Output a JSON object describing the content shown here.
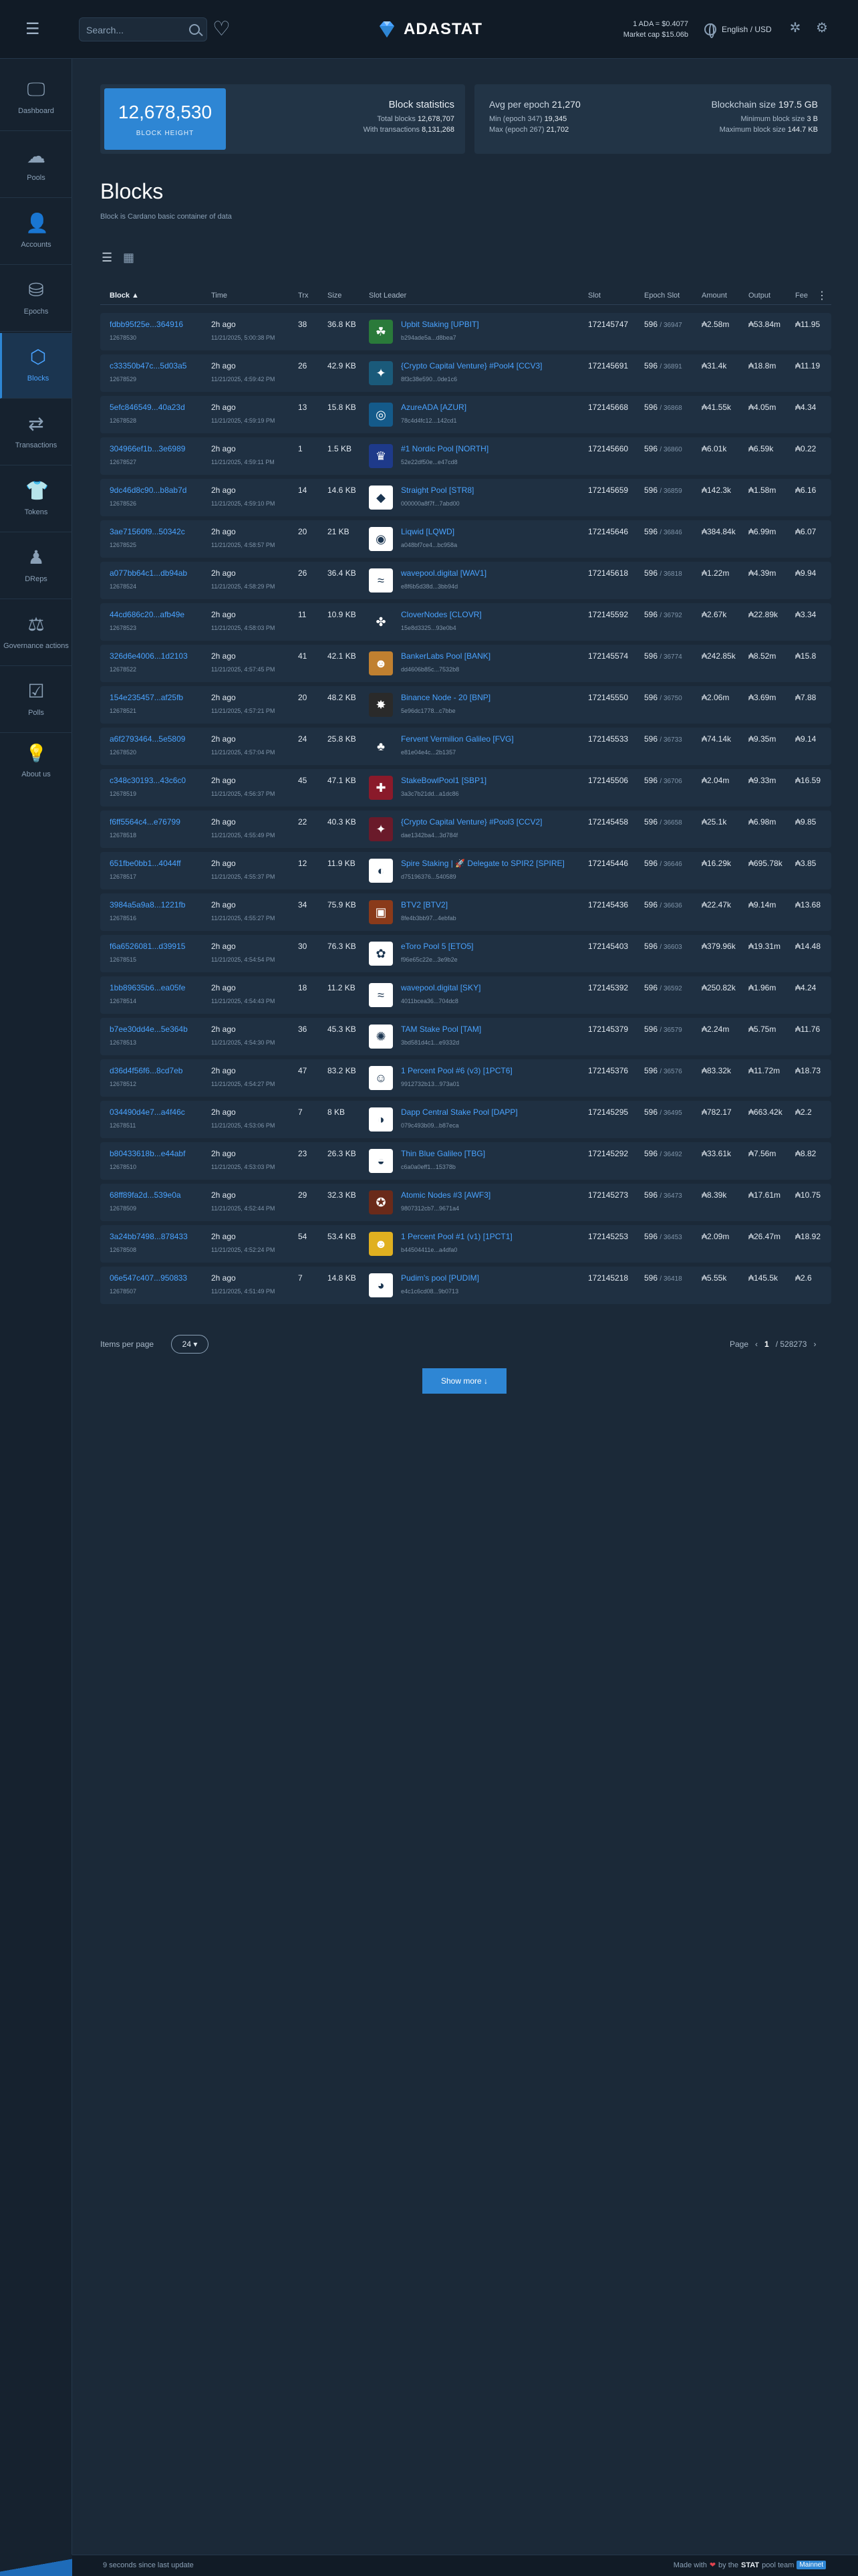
{
  "header": {
    "search_placeholder": "Search...",
    "logo_text": "ADASTAT",
    "price_line": "1 ADA = $0.4077",
    "mcap_line": "Market cap $15.06b",
    "language": "English / USD"
  },
  "sidebar": {
    "items": [
      {
        "label": "Dashboard",
        "icon": "monitor-icon"
      },
      {
        "label": "Pools",
        "icon": "cloud-icon"
      },
      {
        "label": "Accounts",
        "icon": "user-icon"
      },
      {
        "label": "Epochs",
        "icon": "stack-icon"
      },
      {
        "label": "Blocks",
        "icon": "cube-icon"
      },
      {
        "label": "Transactions",
        "icon": "transactions-icon"
      },
      {
        "label": "Tokens",
        "icon": "shirt-icon"
      },
      {
        "label": "DReps",
        "icon": "org-icon"
      },
      {
        "label": "Governance actions",
        "icon": "governance-icon"
      },
      {
        "label": "Polls",
        "icon": "poll-icon"
      }
    ],
    "about": "About us"
  },
  "stats": {
    "block_height": "12,678,530",
    "block_height_label": "BLOCK HEIGHT",
    "block_stats_title": "Block statistics",
    "total_blocks_label": "Total blocks",
    "total_blocks": "12,678,707",
    "with_tx_label": "With transactions",
    "with_tx": "8,131,268",
    "avg_epoch_label": "Avg per epoch",
    "avg_epoch": "21,270",
    "min_epoch_label": "Min (epoch 347)",
    "min_epoch": "19,345",
    "max_epoch_label": "Max (epoch 267)",
    "max_epoch": "21,702",
    "chain_size_label": "Blockchain size",
    "chain_size": "197.5 GB",
    "min_block_label": "Minimum block size",
    "min_block": "3 B",
    "max_block_label": "Maximum block size",
    "max_block": "144.7 KB"
  },
  "page": {
    "title": "Blocks",
    "description": "Block is Cardano basic container of data"
  },
  "table": {
    "columns": [
      "Block",
      "Time",
      "Trx",
      "Size",
      "Slot Leader",
      "Slot",
      "Epoch Slot",
      "Amount",
      "Output",
      "Fee"
    ],
    "rows": [
      {
        "hash": "fdbb95f25e...364916",
        "height": "12678530",
        "time": "2h ago",
        "date": "11/21/2025, 5:00:38 PM",
        "trx": "38",
        "size": "36.8 KB",
        "pool": "Upbit Staking [UPBIT]",
        "poolid": "b294ade5a...d8bea7",
        "slot": "172145747",
        "epoch": "596",
        "eslot": "36947",
        "amount": "₳2.58m",
        "output": "₳53.84m",
        "fee": "₳11.95",
        "icon": "☘",
        "bg": "#2a7a3a"
      },
      {
        "hash": "c33350b47c...5d03a5",
        "height": "12678529",
        "time": "2h ago",
        "date": "11/21/2025, 4:59:42 PM",
        "trx": "26",
        "size": "42.9 KB",
        "pool": "{Crypto Capital Venture} #Pool4 [CCV3]",
        "poolid": "8f3c38e590...0de1c6",
        "slot": "172145691",
        "epoch": "596",
        "eslot": "36891",
        "amount": "₳31.4k",
        "output": "₳18.8m",
        "fee": "₳11.19",
        "icon": "✦",
        "bg": "#1a5a7a"
      },
      {
        "hash": "5efc846549...40a23d",
        "height": "12678528",
        "time": "2h ago",
        "date": "11/21/2025, 4:59:19 PM",
        "trx": "13",
        "size": "15.8 KB",
        "pool": "AzureADA [AZUR]",
        "poolid": "78c4d4fc12...142cd1",
        "slot": "172145668",
        "epoch": "596",
        "eslot": "36868",
        "amount": "₳41.55k",
        "output": "₳4.05m",
        "fee": "₳4.34",
        "icon": "◎",
        "bg": "#145a8a"
      },
      {
        "hash": "304966ef1b...3e6989",
        "height": "12678527",
        "time": "2h ago",
        "date": "11/21/2025, 4:59:11 PM",
        "trx": "1",
        "size": "1.5 KB",
        "pool": "#1 Nordic Pool [NORTH]",
        "poolid": "52e22df50e...e47cd8",
        "slot": "172145660",
        "epoch": "596",
        "eslot": "36860",
        "amount": "₳6.01k",
        "output": "₳6.59k",
        "fee": "₳0.22",
        "icon": "♛",
        "bg": "#1e3a8a"
      },
      {
        "hash": "9dc46d8c90...b8ab7d",
        "height": "12678526",
        "time": "2h ago",
        "date": "11/21/2025, 4:59:10 PM",
        "trx": "14",
        "size": "14.6 KB",
        "pool": "Straight Pool [STR8]",
        "poolid": "000000a8f7f...7abd00",
        "slot": "172145659",
        "epoch": "596",
        "eslot": "36859",
        "amount": "₳142.3k",
        "output": "₳1.58m",
        "fee": "₳6.16",
        "icon": "◆",
        "bg": "#ffffff"
      },
      {
        "hash": "3ae71560f9...50342c",
        "height": "12678525",
        "time": "2h ago",
        "date": "11/21/2025, 4:58:57 PM",
        "trx": "20",
        "size": "21 KB",
        "pool": "Liqwid [LQWD]",
        "poolid": "a048bf7ce4...bc958a",
        "slot": "172145646",
        "epoch": "596",
        "eslot": "36846",
        "amount": "₳384.84k",
        "output": "₳6.99m",
        "fee": "₳6.07",
        "icon": "◉",
        "bg": "#ffffff"
      },
      {
        "hash": "a077bb64c1...db94ab",
        "height": "12678524",
        "time": "2h ago",
        "date": "11/21/2025, 4:58:29 PM",
        "trx": "26",
        "size": "36.4 KB",
        "pool": "wavepool.digital [WAV1]",
        "poolid": "e8f6b5d38d...3bb94d",
        "slot": "172145618",
        "epoch": "596",
        "eslot": "36818",
        "amount": "₳1.22m",
        "output": "₳4.39m",
        "fee": "₳9.94",
        "icon": "≈",
        "bg": "#ffffff"
      },
      {
        "hash": "44cd686c20...afb49e",
        "height": "12678523",
        "time": "2h ago",
        "date": "11/21/2025, 4:58:03 PM",
        "trx": "11",
        "size": "10.9 KB",
        "pool": "CloverNodes [CLOVR]",
        "poolid": "15e8d3325...93e0b4",
        "slot": "172145592",
        "epoch": "596",
        "eslot": "36792",
        "amount": "₳2.67k",
        "output": "₳22.89k",
        "fee": "₳3.34",
        "icon": "✤",
        "bg": "#1f3042"
      },
      {
        "hash": "326d6e4006...1d2103",
        "height": "12678522",
        "time": "2h ago",
        "date": "11/21/2025, 4:57:45 PM",
        "trx": "41",
        "size": "42.1 KB",
        "pool": "BankerLabs Pool [BANK]",
        "poolid": "dd4606b85c...7532b8",
        "slot": "172145574",
        "epoch": "596",
        "eslot": "36774",
        "amount": "₳242.85k",
        "output": "₳8.52m",
        "fee": "₳15.8",
        "icon": "☻",
        "bg": "#c08030"
      },
      {
        "hash": "154e235457...af25fb",
        "height": "12678521",
        "time": "2h ago",
        "date": "11/21/2025, 4:57:21 PM",
        "trx": "20",
        "size": "48.2 KB",
        "pool": "Binance Node - 20 [BNP]",
        "poolid": "5e96dc1778...c7bbe",
        "slot": "172145550",
        "epoch": "596",
        "eslot": "36750",
        "amount": "₳2.06m",
        "output": "₳3.69m",
        "fee": "₳7.88",
        "icon": "✸",
        "bg": "#2a2a2a"
      },
      {
        "hash": "a6f2793464...5e5809",
        "height": "12678520",
        "time": "2h ago",
        "date": "11/21/2025, 4:57:04 PM",
        "trx": "24",
        "size": "25.8 KB",
        "pool": "Fervent Vermilion Galileo [FVG]",
        "poolid": "e81e04e4c...2b1357",
        "slot": "172145533",
        "epoch": "596",
        "eslot": "36733",
        "amount": "₳74.14k",
        "output": "₳9.35m",
        "fee": "₳9.14",
        "icon": "♣",
        "bg": "#1f3042"
      },
      {
        "hash": "c348c30193...43c6c0",
        "height": "12678519",
        "time": "2h ago",
        "date": "11/21/2025, 4:56:37 PM",
        "trx": "45",
        "size": "47.1 KB",
        "pool": "StakeBowlPool1 [SBP1]",
        "poolid": "3a3c7b21dd...a1dc86",
        "slot": "172145506",
        "epoch": "596",
        "eslot": "36706",
        "amount": "₳2.04m",
        "output": "₳9.33m",
        "fee": "₳16.59",
        "icon": "✚",
        "bg": "#8a1a2a"
      },
      {
        "hash": "f6ff5564c4...e76799",
        "height": "12678518",
        "time": "2h ago",
        "date": "11/21/2025, 4:55:49 PM",
        "trx": "22",
        "size": "40.3 KB",
        "pool": "{Crypto Capital Venture} #Pool3 [CCV2]",
        "poolid": "dae1342ba4...3d784f",
        "slot": "172145458",
        "epoch": "596",
        "eslot": "36658",
        "amount": "₳25.1k",
        "output": "₳6.98m",
        "fee": "₳9.85",
        "icon": "✦",
        "bg": "#6a1a2a"
      },
      {
        "hash": "651fbe0bb1...4044ff",
        "height": "12678517",
        "time": "2h ago",
        "date": "11/21/2025, 4:55:37 PM",
        "trx": "12",
        "size": "11.9 KB",
        "pool": "Spire Staking | 🚀 Delegate to SPIR2 [SPIRE]",
        "poolid": "d75196376...540589",
        "slot": "172145446",
        "epoch": "596",
        "eslot": "36646",
        "amount": "₳16.29k",
        "output": "₳695.78k",
        "fee": "₳3.85",
        "icon": "◐",
        "bg": "#ffffff"
      },
      {
        "hash": "3984a5a9a8...1221fb",
        "height": "12678516",
        "time": "2h ago",
        "date": "11/21/2025, 4:55:27 PM",
        "trx": "34",
        "size": "75.9 KB",
        "pool": "BTV2 [BTV2]",
        "poolid": "8fe4b3bb97...4ebfab",
        "slot": "172145436",
        "epoch": "596",
        "eslot": "36636",
        "amount": "₳22.47k",
        "output": "₳9.14m",
        "fee": "₳13.68",
        "icon": "▣",
        "bg": "#8a3a1a"
      },
      {
        "hash": "f6a6526081...d39915",
        "height": "12678515",
        "time": "2h ago",
        "date": "11/21/2025, 4:54:54 PM",
        "trx": "30",
        "size": "76.3 KB",
        "pool": "eToro Pool 5 [ETO5]",
        "poolid": "f96e65c22e...3e9b2e",
        "slot": "172145403",
        "epoch": "596",
        "eslot": "36603",
        "amount": "₳379.96k",
        "output": "₳19.31m",
        "fee": "₳14.48",
        "icon": "✿",
        "bg": "#ffffff"
      },
      {
        "hash": "1bb89635b6...ea05fe",
        "height": "12678514",
        "time": "2h ago",
        "date": "11/21/2025, 4:54:43 PM",
        "trx": "18",
        "size": "11.2 KB",
        "pool": "wavepool.digital [SKY]",
        "poolid": "4011bcea36...704dc8",
        "slot": "172145392",
        "epoch": "596",
        "eslot": "36592",
        "amount": "₳250.82k",
        "output": "₳1.96m",
        "fee": "₳4.24",
        "icon": "≈",
        "bg": "#ffffff"
      },
      {
        "hash": "b7ee30dd4e...5e364b",
        "height": "12678513",
        "time": "2h ago",
        "date": "11/21/2025, 4:54:30 PM",
        "trx": "36",
        "size": "45.3 KB",
        "pool": "TAM Stake Pool [TAM]",
        "poolid": "3bd581d4c1...e9332d",
        "slot": "172145379",
        "epoch": "596",
        "eslot": "36579",
        "amount": "₳2.24m",
        "output": "₳5.75m",
        "fee": "₳11.76",
        "icon": "✺",
        "bg": "#ffffff"
      },
      {
        "hash": "d36d4f56f6...8cd7eb",
        "height": "12678512",
        "time": "2h ago",
        "date": "11/21/2025, 4:54:27 PM",
        "trx": "47",
        "size": "83.2 KB",
        "pool": "1 Percent Pool #6 (v3) [1PCT6]",
        "poolid": "9912732b13...973a01",
        "slot": "172145376",
        "epoch": "596",
        "eslot": "36576",
        "amount": "₳83.32k",
        "output": "₳11.72m",
        "fee": "₳18.73",
        "icon": "☺",
        "bg": "#ffffff"
      },
      {
        "hash": "034490d4e7...a4f46c",
        "height": "12678511",
        "time": "2h ago",
        "date": "11/21/2025, 4:53:06 PM",
        "trx": "7",
        "size": "8 KB",
        "pool": "Dapp Central Stake Pool [DAPP]",
        "poolid": "079c493b09...b87eca",
        "slot": "172145295",
        "epoch": "596",
        "eslot": "36495",
        "amount": "₳782.17",
        "output": "₳663.42k",
        "fee": "₳2.2",
        "icon": "◑",
        "bg": "#ffffff"
      },
      {
        "hash": "b80433618b...e44abf",
        "height": "12678510",
        "time": "2h ago",
        "date": "11/21/2025, 4:53:03 PM",
        "trx": "23",
        "size": "26.3 KB",
        "pool": "Thin Blue Galileo [TBG]",
        "poolid": "c6a0a0eff1...15378b",
        "slot": "172145292",
        "epoch": "596",
        "eslot": "36492",
        "amount": "₳33.61k",
        "output": "₳7.56m",
        "fee": "₳8.82",
        "icon": "◒",
        "bg": "#ffffff"
      },
      {
        "hash": "68ff89fa2d...539e0a",
        "height": "12678509",
        "time": "2h ago",
        "date": "11/21/2025, 4:52:44 PM",
        "trx": "29",
        "size": "32.3 KB",
        "pool": "Atomic Nodes #3 [AWF3]",
        "poolid": "9807312cb7...9671a4",
        "slot": "172145273",
        "epoch": "596",
        "eslot": "36473",
        "amount": "₳8.39k",
        "output": "₳17.61m",
        "fee": "₳10.75",
        "icon": "✪",
        "bg": "#6a2a1a"
      },
      {
        "hash": "3a24bb7498...878433",
        "height": "12678508",
        "time": "2h ago",
        "date": "11/21/2025, 4:52:24 PM",
        "trx": "54",
        "size": "53.4 KB",
        "pool": "1 Percent Pool #1 (v1) [1PCT1]",
        "poolid": "b44504411e...a4dfa0",
        "slot": "172145253",
        "epoch": "596",
        "eslot": "36453",
        "amount": "₳2.09m",
        "output": "₳26.47m",
        "fee": "₳18.92",
        "icon": "☻",
        "bg": "#e0b020"
      },
      {
        "hash": "06e547c407...950833",
        "height": "12678507",
        "time": "2h ago",
        "date": "11/21/2025, 4:51:49 PM",
        "trx": "7",
        "size": "14.8 KB",
        "pool": "Pudim's pool [PUDIM]",
        "poolid": "e4c1c6cd08...9b0713",
        "slot": "172145218",
        "epoch": "596",
        "eslot": "36418",
        "amount": "₳5.55k",
        "output": "₳145.5k",
        "fee": "₳2.6",
        "icon": "◕",
        "bg": "#ffffff"
      }
    ]
  },
  "pagination": {
    "items_per_page_label": "Items per page",
    "items_per_page": "24",
    "page_label": "Page",
    "current_page": "1",
    "total_pages": "/ 528273",
    "show_more": "Show more ↓"
  },
  "footer": {
    "last_update": "9 seconds since last update",
    "made_with": "Made with",
    "by_the": "by the",
    "team_name": "STAT",
    "team_suffix": "pool team",
    "badge": "Mainnet"
  },
  "colors": {
    "accent": "#2e86d4",
    "link": "#4aa3ff",
    "background": "#1b2938"
  }
}
